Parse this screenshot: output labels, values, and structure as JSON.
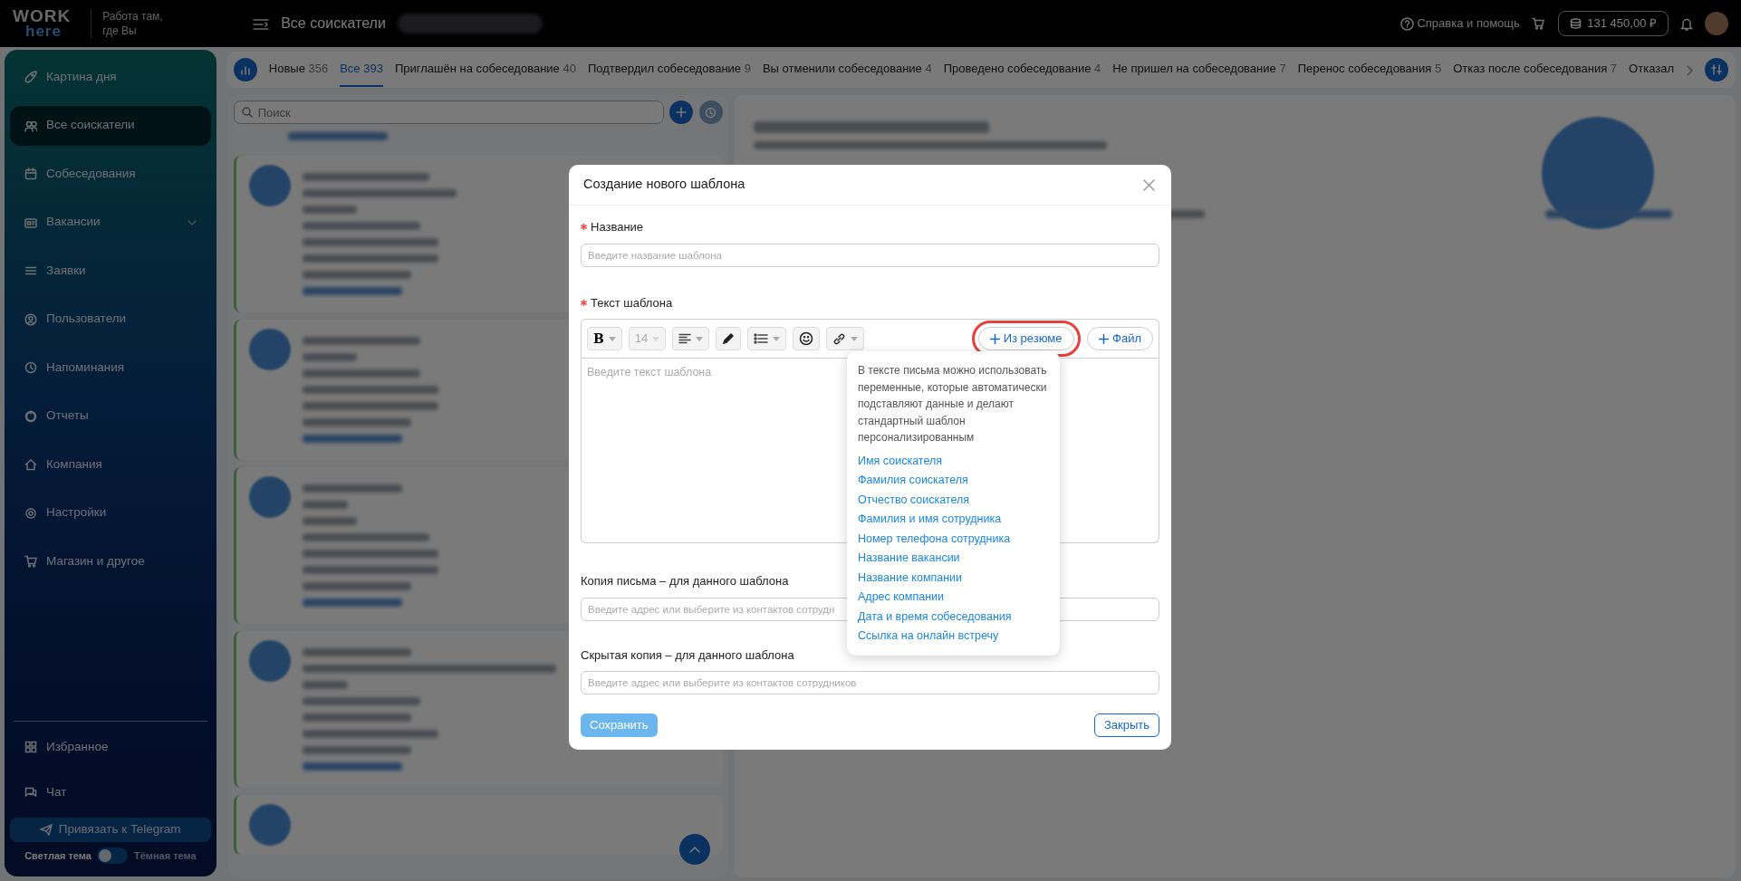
{
  "topbar": {
    "logo_top": "WORK",
    "logo_bottom": "here",
    "tagline_lines": [
      "Работа там,",
      "где Вы"
    ],
    "page_title": "Все соискатели",
    "help": "Справка и помощь",
    "balance": "131 450,00 ₽"
  },
  "sidebar": {
    "items": [
      {
        "label": "Картина дня",
        "selected": false,
        "expandable": false
      },
      {
        "label": "Все соискатели",
        "selected": true,
        "expandable": false
      },
      {
        "label": "Собеседования",
        "selected": false,
        "expandable": false
      },
      {
        "label": "Вакансии",
        "selected": false,
        "expandable": true
      },
      {
        "label": "Заявки",
        "selected": false,
        "expandable": false
      },
      {
        "label": "Пользователи",
        "selected": false,
        "expandable": false
      },
      {
        "label": "Напоминания",
        "selected": false,
        "expandable": false
      },
      {
        "label": "Отчеты",
        "selected": false,
        "expandable": false
      },
      {
        "label": "Компания",
        "selected": false,
        "expandable": false
      },
      {
        "label": "Настройки",
        "selected": false,
        "expandable": false
      },
      {
        "label": "Магазин и другое",
        "selected": false,
        "expandable": false
      }
    ],
    "bottom_items": [
      {
        "label": "Избранное",
        "selected": false
      },
      {
        "label": "Чат",
        "selected": false
      }
    ],
    "telegram_button": "Привязать к Telegram",
    "theme": {
      "light_label": "Светлая тема",
      "dark_label": "Тёмная тема",
      "dark": false
    }
  },
  "tabs": [
    {
      "label": "Новые",
      "count": "356",
      "selected": false
    },
    {
      "label": "Все",
      "count": "393",
      "selected": true
    },
    {
      "label": "Приглашён на собеседование",
      "count": "40",
      "selected": false
    },
    {
      "label": "Подтвердил собеседование",
      "count": "9",
      "selected": false
    },
    {
      "label": "Вы отменили собеседование",
      "count": "4",
      "selected": false
    },
    {
      "label": "Проведено собеседование",
      "count": "4",
      "selected": false
    },
    {
      "label": "Не пришел на собеседование",
      "count": "7",
      "selected": false
    },
    {
      "label": "Перенос собеседования",
      "count": "5",
      "selected": false
    },
    {
      "label": "Отказ после собеседования",
      "count": "7",
      "selected": false
    },
    {
      "label": "Отказал",
      "selected": false
    }
  ],
  "search": {
    "placeholder": "Поиск"
  },
  "modal": {
    "title": "Создание нового шаблона",
    "fields": [
      {
        "kind": "input",
        "label": "Название",
        "required": true,
        "placeholder": "Введите название шаблона"
      },
      {
        "kind": "editor",
        "label": "Текст шаблона",
        "required": true,
        "placeholder": "Введите текст шаблона"
      },
      {
        "kind": "input",
        "label": "Копия письма – для данного шаблона",
        "required": false,
        "placeholder": "Введите адрес или выберите из контактов сотрудн"
      },
      {
        "kind": "input",
        "label": "Скрытая копия – для данного шаблона",
        "required": false,
        "placeholder": "Введите адрес или выберите из контактов сотрудников"
      }
    ],
    "toolbar": [
      {
        "kind": "bold",
        "label": "B",
        "dropdown": true,
        "disabled": false
      },
      {
        "kind": "size",
        "label": "14",
        "dropdown": true,
        "disabled": true
      },
      {
        "kind": "align",
        "dropdown": true,
        "disabled": false
      },
      {
        "kind": "pen",
        "dropdown": false,
        "disabled": false
      },
      {
        "kind": "list",
        "dropdown": true,
        "disabled": false
      },
      {
        "kind": "emoji",
        "dropdown": false,
        "disabled": false
      },
      {
        "kind": "link",
        "dropdown": true,
        "disabled": false
      }
    ],
    "insert_buttons": [
      {
        "label": "Из резюме",
        "highlighted": true
      },
      {
        "label": "Файл",
        "highlighted": false
      }
    ],
    "popover": {
      "description": "В тексте письма можно использовать переменные, которые автоматически подставляют данные и делают стандартный шаблон персонализированным",
      "variables": [
        "Имя соискателя",
        "Фамилия соискателя",
        "Отчество соискателя",
        "Фамилия и имя сотрудника",
        "Номер телефона сотрудника",
        "Название вакансии",
        "Название компании",
        "Адрес компании",
        "Дата и время собеседования",
        "Ссылка на онлайн встречу"
      ]
    },
    "save_button": {
      "label": "Сохранить",
      "disabled": true
    },
    "close_button": {
      "label": "Закрыть"
    }
  }
}
